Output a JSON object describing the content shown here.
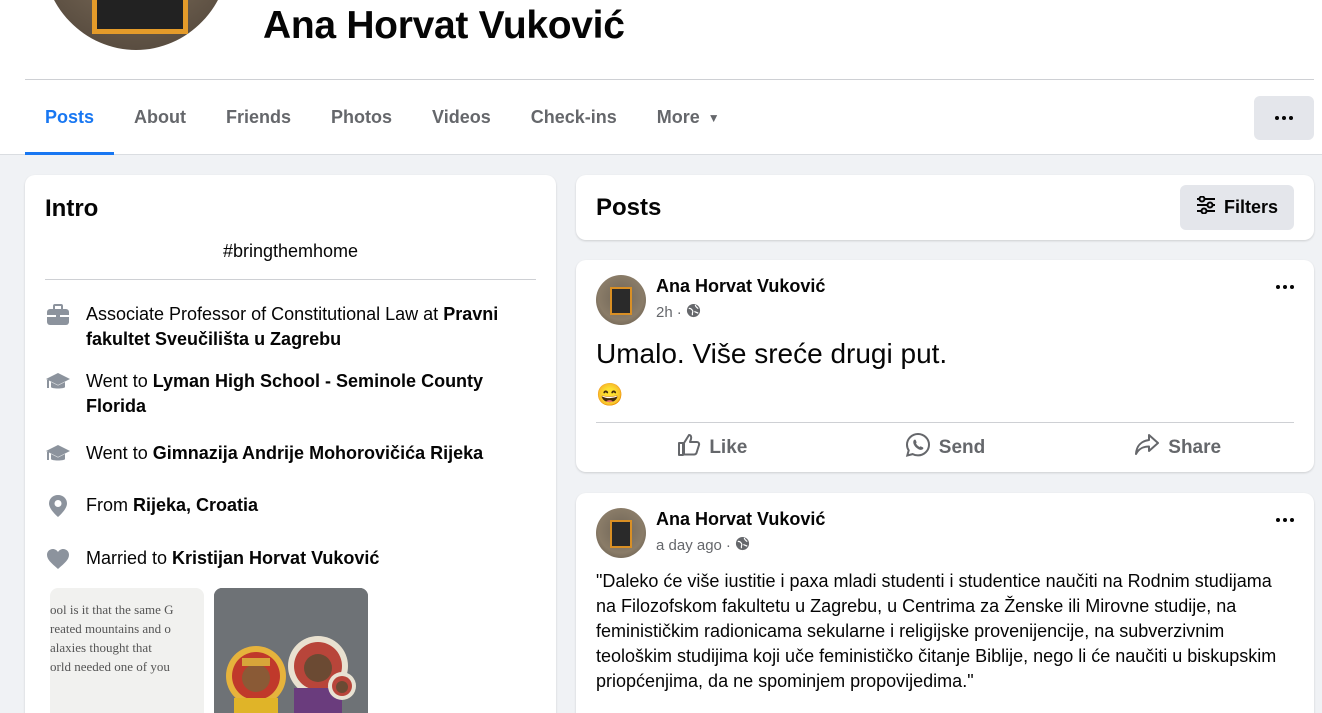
{
  "profile": {
    "name": "Ana Horvat Vuković"
  },
  "tabs": [
    {
      "label": "Posts"
    },
    {
      "label": "About"
    },
    {
      "label": "Friends"
    },
    {
      "label": "Photos"
    },
    {
      "label": "Videos"
    },
    {
      "label": "Check-ins"
    },
    {
      "label": "More"
    }
  ],
  "intro": {
    "title": "Intro",
    "bio": "#bringthemhome",
    "items": [
      {
        "icon": "briefcase-icon",
        "prefix": "Associate Professor of Constitutional Law at ",
        "bold": "Pravni fakultet Sveučilišta u Zagrebu"
      },
      {
        "icon": "graduation-cap-icon",
        "prefix": "Went to ",
        "bold": "Lyman High School - Seminole County Florida"
      },
      {
        "icon": "graduation-cap-icon",
        "prefix": "Went to ",
        "bold": "Gimnazija Andrije Mohorovičića Rijeka"
      },
      {
        "icon": "location-pin-icon",
        "prefix": "From ",
        "bold": "Rijeka, Croatia"
      },
      {
        "icon": "heart-icon",
        "prefix": "Married to ",
        "bold": "Kristijan Horvat Vuković"
      }
    ],
    "photo1_lines": [
      "ool is it that the same G",
      "reated mountains and o",
      "alaxies thought that",
      "orld needed one of you"
    ]
  },
  "posts_header": {
    "title": "Posts",
    "filters_label": "Filters"
  },
  "posts": [
    {
      "author": "Ana Horvat Vuković",
      "time": "2h",
      "text": "Umalo. Više sreće drugi put.",
      "emoji": "😄",
      "actions": {
        "like": "Like",
        "send": "Send",
        "share": "Share"
      }
    },
    {
      "author": "Ana Horvat Vuković",
      "time": "a day ago",
      "text": "\"Daleko će više iustitie i paxa mladi studenti i studentice naučiti na Rodnim studijama na Filozofskom fakultetu u Zagrebu, u Centrima za Ženske ili Mirovne studije, na feminističkim radionicama sekularne i religijske provenijencije, na subverzivnim teološkim studijima koji uče feminističko čitanje Biblije, nego li će naučiti u biskupskim priopćenjima, da ne spominjem propovijedima.\""
    }
  ],
  "colors": {
    "accent": "#1877f2",
    "secondary_text": "#65676b",
    "background": "#f0f2f5"
  }
}
